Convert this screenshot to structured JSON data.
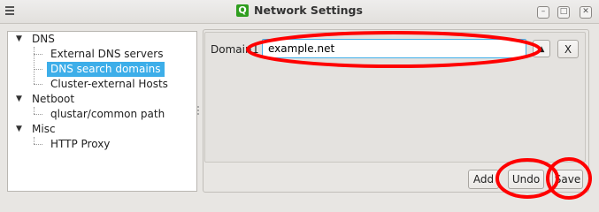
{
  "window": {
    "title": "Network Settings",
    "app_icon_letter": "Q",
    "controls": {
      "minimize": "–",
      "maximize": "□",
      "close": "✕"
    }
  },
  "tree": {
    "items": [
      {
        "label": "DNS",
        "level": 0,
        "expanded": true
      },
      {
        "label": "External DNS servers",
        "level": 1
      },
      {
        "label": "DNS search domains",
        "level": 1,
        "selected": true
      },
      {
        "label": "Cluster-external Hosts",
        "level": 1
      },
      {
        "label": "Netboot",
        "level": 0,
        "expanded": true
      },
      {
        "label": "qlustar/common path",
        "level": 1
      },
      {
        "label": "Misc",
        "level": 0,
        "expanded": true
      },
      {
        "label": "HTTP Proxy",
        "level": 1
      }
    ]
  },
  "form": {
    "domain_label": "Domain",
    "domain_index": "1",
    "domain_value": "example.net",
    "up_icon": "chevron-up-icon",
    "remove_label": "X"
  },
  "buttons": {
    "add": "Add",
    "undo": "Undo",
    "save": "Save"
  },
  "colors": {
    "selection": "#3daee9",
    "annotation": "#ff0000",
    "app_icon": "#2f9e1f"
  }
}
